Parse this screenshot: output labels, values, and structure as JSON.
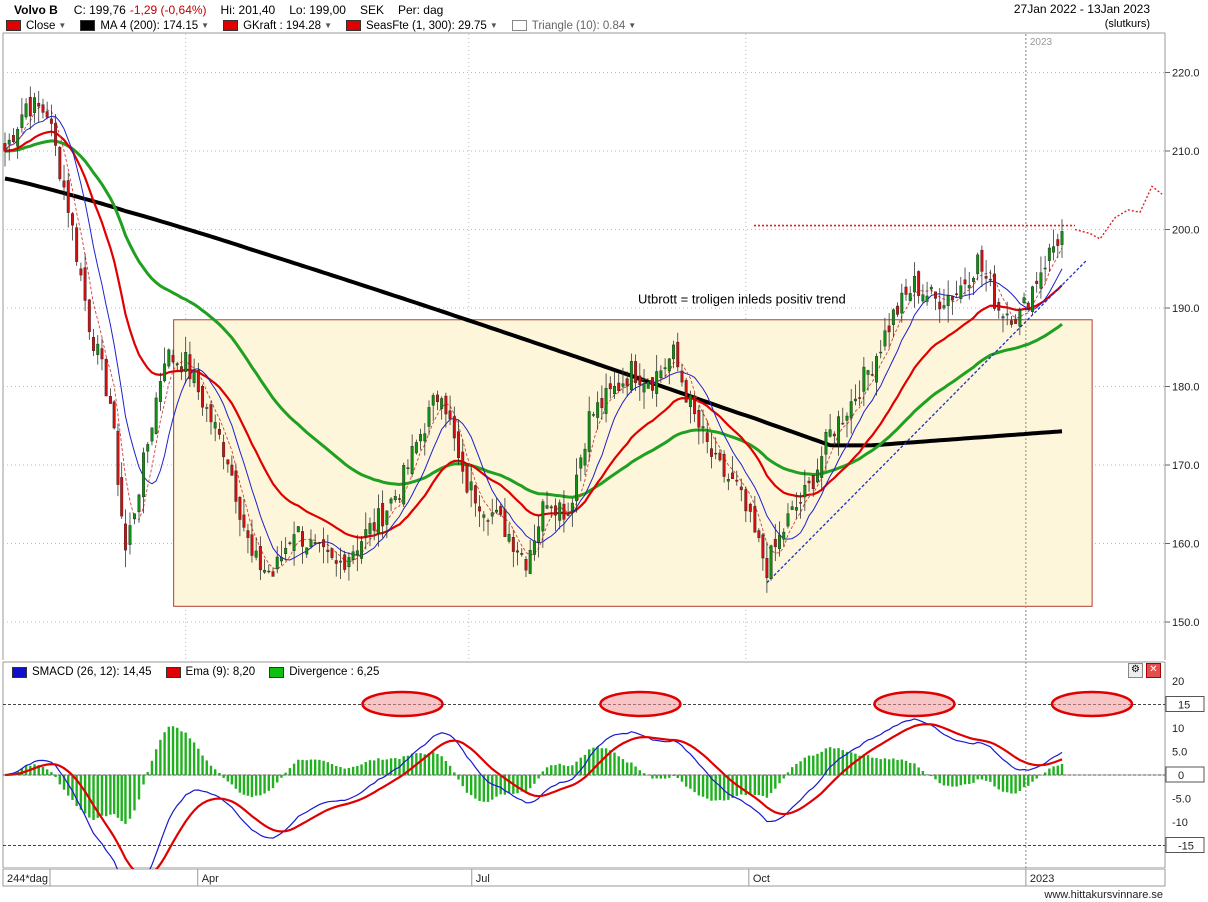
{
  "header": {
    "symbol": "Volvo B",
    "close_label": "C: 199,76",
    "change": "-1,29 (-0,64%)",
    "hi_label": "Hi: 201,40",
    "lo_label": "Lo: 199,00",
    "currency": "SEK",
    "period_label": "Per: dag",
    "date_range": "27Jan 2022 - 13Jan 2023",
    "close_type": "(slutkurs)"
  },
  "legend": [
    {
      "label": "Close",
      "color": "#e00000"
    },
    {
      "label": "MA 4 (200): 174.15",
      "color": "#000000"
    },
    {
      "label": "GKraft : 194.28",
      "color": "#e00000"
    },
    {
      "label": "SeasFte (1, 300): 29.75",
      "color": "#e00000"
    },
    {
      "label": "Triangle (10): 0.84",
      "color": "#ffffff"
    }
  ],
  "annotations": {
    "breakout_text": "Utbrott = troligen inleds positiv trend",
    "year_marker": "2023"
  },
  "indicator": {
    "legend": [
      {
        "label": "SMACD (26, 12): 14,45",
        "color": "#1010cc"
      },
      {
        "label": "Ema (9): 8,20",
        "color": "#e00000"
      },
      {
        "label": "Divergence : 6,25",
        "color": "#10c010"
      }
    ],
    "settings_icon": "wrench-icon",
    "close_icon": "close-icon"
  },
  "x_axis": {
    "period_badge": "244*dag",
    "labels": [
      "Apr",
      "Jul",
      "Oct",
      "2023"
    ]
  },
  "footer": {
    "site": "www.hittakursvinnare.se"
  },
  "chart_data": [
    {
      "type": "candlestick",
      "title": "Volvo B",
      "ylim": [
        145,
        225
      ],
      "y_ticks": [
        150,
        160,
        170,
        180,
        190,
        200,
        210,
        220
      ],
      "y_tick_labels": [
        "150.0",
        "160.0",
        "170.0",
        "180.0",
        "190.0",
        "200.0",
        "210.0",
        "220.0"
      ],
      "x_range": [
        "2022-01-27",
        "2023-01-13"
      ],
      "grid": true,
      "close_approx": [
        [
          "2022-01-27",
          210
        ],
        [
          "2022-02-03",
          216
        ],
        [
          "2022-02-10",
          215
        ],
        [
          "2022-02-17",
          203
        ],
        [
          "2022-02-24",
          188
        ],
        [
          "2022-03-03",
          178
        ],
        [
          "2022-03-08",
          159
        ],
        [
          "2022-03-14",
          170
        ],
        [
          "2022-03-21",
          184
        ],
        [
          "2022-03-28",
          183
        ],
        [
          "2022-04-04",
          177
        ],
        [
          "2022-04-11",
          171
        ],
        [
          "2022-04-19",
          158
        ],
        [
          "2022-04-26",
          156
        ],
        [
          "2022-05-03",
          162
        ],
        [
          "2022-05-10",
          159
        ],
        [
          "2022-05-17",
          157
        ],
        [
          "2022-05-24",
          160
        ],
        [
          "2022-05-31",
          163
        ],
        [
          "2022-06-07",
          167
        ],
        [
          "2022-06-14",
          174
        ],
        [
          "2022-06-21",
          180
        ],
        [
          "2022-06-28",
          168
        ],
        [
          "2022-07-05",
          165
        ],
        [
          "2022-07-12",
          162
        ],
        [
          "2022-07-19",
          158
        ],
        [
          "2022-07-26",
          166
        ],
        [
          "2022-08-02",
          164
        ],
        [
          "2022-08-09",
          176
        ],
        [
          "2022-08-16",
          179
        ],
        [
          "2022-08-23",
          182
        ],
        [
          "2022-08-30",
          181
        ],
        [
          "2022-09-06",
          184
        ],
        [
          "2022-09-13",
          176
        ],
        [
          "2022-09-20",
          170
        ],
        [
          "2022-09-27",
          167
        ],
        [
          "2022-10-03",
          161
        ],
        [
          "2022-10-07",
          157
        ],
        [
          "2022-10-14",
          163
        ],
        [
          "2022-10-21",
          167
        ],
        [
          "2022-10-28",
          174
        ],
        [
          "2022-11-04",
          178
        ],
        [
          "2022-11-11",
          183
        ],
        [
          "2022-11-18",
          189
        ],
        [
          "2022-11-25",
          193
        ],
        [
          "2022-12-02",
          191
        ],
        [
          "2022-12-09",
          192
        ],
        [
          "2022-12-16",
          196
        ],
        [
          "2022-12-23",
          190
        ],
        [
          "2022-12-30",
          189
        ],
        [
          "2023-01-06",
          195
        ],
        [
          "2023-01-13",
          199.76
        ]
      ],
      "series": [
        {
          "name": "MA 4 (200)",
          "color": "#000000",
          "last": 174.15
        },
        {
          "name": "GKraft",
          "color": "#e00000",
          "last": 194.28
        },
        {
          "name": "SeasFte (1, 300)",
          "color": "#e00000",
          "last": 29.75
        }
      ],
      "overlays": {
        "range_box": {
          "from": "2022-03-24",
          "to": "2023-01-23",
          "low": 152,
          "high": 188.5
        },
        "resistance_level": 200.5,
        "support_trendline": [
          [
            "2022-10-07",
            155
          ],
          [
            "2023-01-13",
            196
          ]
        ]
      }
    },
    {
      "type": "line",
      "ylim": [
        -20,
        20
      ],
      "y_ticks": [
        20,
        15,
        10,
        5,
        0,
        -5,
        -10,
        -15
      ],
      "y_tick_labels": [
        "20",
        "15",
        "10",
        "5.0",
        "0",
        "-5.0",
        "-10",
        "-15"
      ],
      "highlighted_ticks": [
        "15",
        "0",
        "-15"
      ],
      "series": [
        {
          "name": "SMACD (26, 12)",
          "color": "#1010cc",
          "last": 14.45
        },
        {
          "name": "Ema (9)",
          "color": "#e00000",
          "last": 8.2
        },
        {
          "name": "Divergence",
          "color": "#10c010",
          "last": 6.25,
          "style": "histogram"
        }
      ],
      "highlighted_peaks": [
        "2022-06-08",
        "2022-08-26",
        "2022-11-25",
        "2023-01-13"
      ]
    }
  ]
}
